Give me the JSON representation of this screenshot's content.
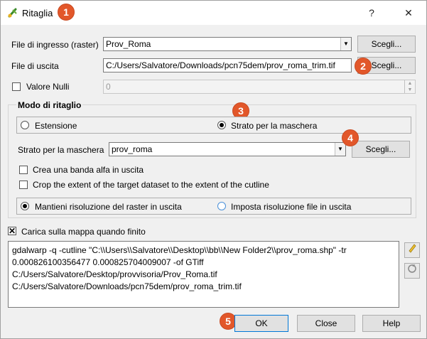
{
  "window": {
    "title": "Ritaglia",
    "help_glyph": "?",
    "close_glyph": "✕"
  },
  "badges": [
    "1",
    "2",
    "3",
    "4",
    "5"
  ],
  "input_raster": {
    "label": "File di ingresso (raster)",
    "value": "Prov_Roma",
    "browse_label": "Scegli..."
  },
  "output_file": {
    "label": "File di uscita",
    "value": "C:/Users/Salvatore/Downloads/pcn75dem/prov_roma_trim.tif",
    "browse_label": "Scegli..."
  },
  "nodata": {
    "label": "Valore Nulli",
    "checked": false,
    "value": "0"
  },
  "clip_mode": {
    "title": "Modo di ritaglio",
    "option_extent": "Estensione",
    "option_mask": "Strato per la maschera",
    "selected": "mask",
    "mask_layer_label": "Strato per la maschera",
    "mask_layer_value": "prov_roma",
    "mask_browse_label": "Scegli...",
    "alpha_band_label": "Crea una banda alfa in uscita",
    "crop_label": "Crop the extent of the target dataset to the extent of the cutline",
    "keep_resolution_label": "Mantieni risoluzione del raster in uscita",
    "set_resolution_label": "Imposta risoluzione file in uscita"
  },
  "load_on_finish": {
    "label": "Carica sulla mappa quando finito",
    "checked": true
  },
  "command_lines": [
    "gdalwarp -q -cutline \"C:\\\\Users\\\\Salvatore\\\\Desktop\\\\bb\\\\New Folder2\\\\prov_roma.shp\" -tr",
    "0.000826100356477 0.000825704009007 -of GTiff",
    "C:/Users/Salvatore/Desktop/provvisoria/Prov_Roma.tif",
    "C:/Users/Salvatore/Downloads/pcn75dem/prov_roma_trim.tif"
  ],
  "buttons": {
    "ok": "OK",
    "close": "Close",
    "help": "Help"
  },
  "icons": {
    "app": "qgis-clip-icon",
    "edit": "pencil-icon",
    "reset": "reset-icon"
  }
}
